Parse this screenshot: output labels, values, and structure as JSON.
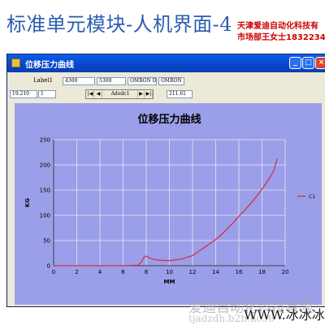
{
  "banner": {
    "title": "标准单元模块-人机界面-4",
    "company_line1": "天津爱迪自动化科技有",
    "company_line2": "市场部王女士1832234"
  },
  "window": {
    "title": "位移压力曲线",
    "buttons": {
      "minimize": "_",
      "maximize": "□",
      "close": "×"
    }
  },
  "controls": {
    "label1": "Label1",
    "text1": "4300",
    "text2": "5300",
    "text3": "OMRON DM43",
    "text4": "OMRON DM",
    "text5": "19.210",
    "text6": "1",
    "text7": "211.61",
    "adodc_caption": "Adodc1",
    "nav_first": "|◀",
    "nav_prev": "◀",
    "nav_next": "▶",
    "nav_last": "▶|"
  },
  "watermark": {
    "line1": "爱迪自动化科技有限",
    "line2": "tjadzdh.b2b.hc36",
    "line3": "WWW.冰冰冰"
  },
  "colors": {
    "chart_bg": "#9b9ee8",
    "grid": "#e8e8f8",
    "line": "#d0324a",
    "title_bar": "#0a5fe8"
  },
  "chart_data": {
    "type": "line",
    "title": "位移压力曲线",
    "xlabel": "MM",
    "ylabel": "KG",
    "xlim": [
      0,
      20
    ],
    "ylim": [
      0,
      250
    ],
    "xticks": [
      0,
      2,
      4,
      6,
      8,
      10,
      12,
      14,
      16,
      18,
      20
    ],
    "yticks": [
      0,
      50,
      100,
      150,
      200,
      250
    ],
    "grid": true,
    "legend": "right",
    "series": [
      {
        "name": "C1",
        "x": [
          0,
          2,
          4,
          6,
          7.3,
          7.6,
          7.8,
          8.0,
          8.3,
          9,
          10,
          11,
          12,
          12.5,
          13,
          13.5,
          14,
          14.5,
          15,
          15.5,
          16,
          16.5,
          17,
          17.5,
          18,
          18.5,
          19,
          19.3
        ],
        "y": [
          0,
          0,
          0,
          0,
          1,
          8,
          17,
          19,
          15,
          11,
          10,
          13,
          20,
          28,
          36,
          44,
          52,
          62,
          73,
          85,
          98,
          110,
          123,
          137,
          152,
          168,
          188,
          212
        ]
      }
    ]
  }
}
